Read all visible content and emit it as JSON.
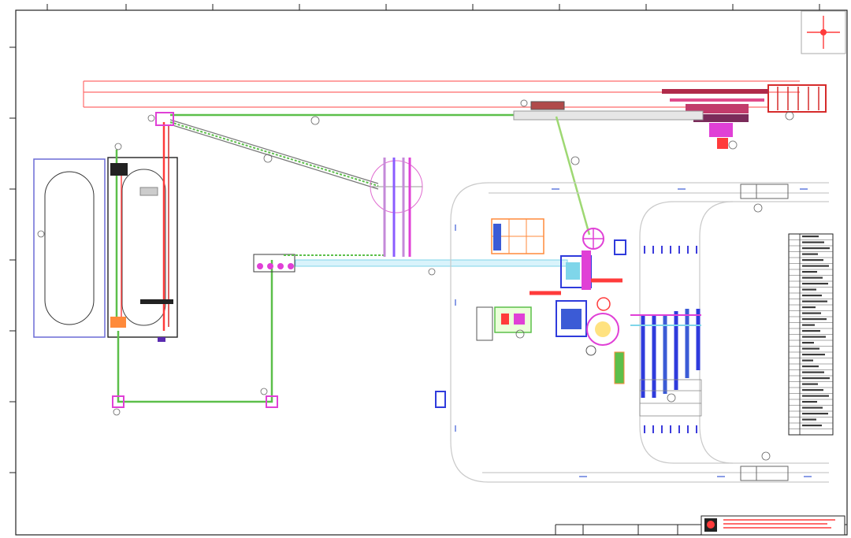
{
  "drawing": {
    "lane_label": "",
    "callouts": {
      "c_top_left": "",
      "c_conveyor": "",
      "c_incline": "",
      "c_green_vertical": "",
      "c_tank": "",
      "c_bottom_left": "",
      "c_bottom_mid": "",
      "c_center_pipe": "",
      "c_top_right": "",
      "c_right_machine": "",
      "c_mid_right": "",
      "c_road_top": "",
      "c_road_bottom": "",
      "c_bay": ""
    }
  },
  "parts_list": {
    "header": "",
    "rows": []
  },
  "title_block": {
    "text": ""
  },
  "colors": {
    "red": "#ff3b3b",
    "green": "#5cbf4a",
    "light_green": "#9ed873",
    "magenta": "#e040d6",
    "blue": "#2f3bdc",
    "cyan": "#7fd6ea",
    "purple": "#8a5cff",
    "gray": "#9a9a9a"
  },
  "icons": [
    "compass-rose-icon",
    "logo-icon"
  ]
}
